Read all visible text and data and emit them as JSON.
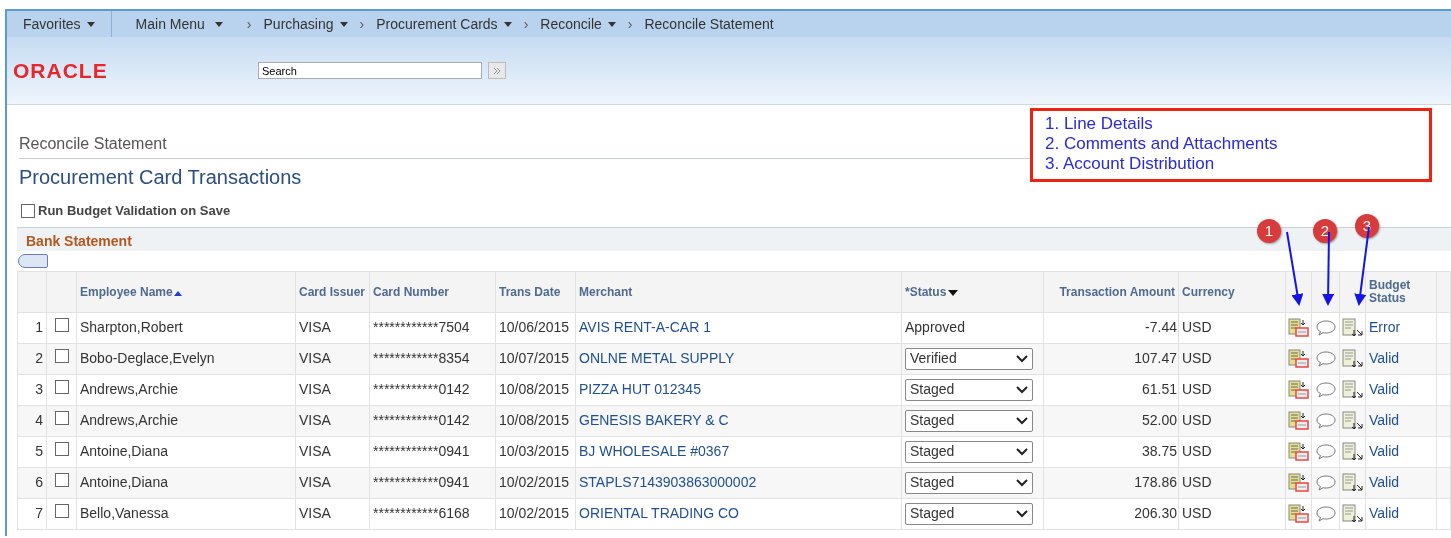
{
  "nav": {
    "favorites": "Favorites",
    "main_menu": "Main Menu",
    "separators": [
      "›",
      "›",
      "›",
      "›"
    ],
    "crumbs": [
      {
        "label": "Purchasing",
        "dropdown": true
      },
      {
        "label": "Procurement Cards",
        "dropdown": true
      },
      {
        "label": "Reconcile",
        "dropdown": true
      },
      {
        "label": "Reconcile Statement",
        "dropdown": false
      }
    ]
  },
  "banner": {
    "logo": "ORACLE",
    "search": {
      "value": "Search"
    }
  },
  "page": {
    "subtitle": "Reconcile Statement",
    "title": "Procurement Card Transactions",
    "budget_validation": {
      "label": "Run Budget Validation on Save",
      "checked": false
    }
  },
  "legend": {
    "items": [
      "1. Line Details",
      "2. Comments and Attachments",
      "3. Account Distribution"
    ]
  },
  "callouts": [
    {
      "number": "1"
    },
    {
      "number": "2"
    },
    {
      "number": "3"
    }
  ],
  "grid": {
    "title": "Bank Statement",
    "columns": [
      {
        "label": "Employee Name",
        "sorted": true,
        "ascending": true
      },
      {
        "label": "Card Issuer",
        "sorted": false
      },
      {
        "label": "Card Number",
        "sorted": false
      },
      {
        "label": "Trans Date",
        "sorted": false
      },
      {
        "label": "Merchant",
        "sorted": false
      },
      {
        "label": "*Status",
        "sorted": true,
        "ascending": false
      },
      {
        "label": "Transaction Amount",
        "sorted": false
      },
      {
        "label": "Currency",
        "sorted": false
      },
      {
        "label": "Budget Status",
        "sorted": false
      }
    ],
    "rows": [
      {
        "num": "1",
        "checked": false,
        "employee": "Sharpton,Robert",
        "issuer": "VISA",
        "card": "************7504",
        "date": "10/06/2015",
        "merchant": "AVIS RENT-A-CAR 1",
        "status": "Approved",
        "kind": "text",
        "amount": "-7.44",
        "currency": "USD",
        "budget_status": "Error"
      },
      {
        "num": "2",
        "checked": false,
        "employee": "Bobo-Deglace,Evelyn",
        "issuer": "VISA",
        "card": "************8354",
        "date": "10/07/2015",
        "merchant": "ONLNE METAL SUPPLY",
        "status": "Verified",
        "kind": "select",
        "amount": "107.47",
        "currency": "USD",
        "budget_status": "Valid"
      },
      {
        "num": "3",
        "checked": false,
        "employee": "Andrews,Archie",
        "issuer": "VISA",
        "card": "************0142",
        "date": "10/08/2015",
        "merchant": "PIZZA HUT 012345",
        "status": "Staged",
        "kind": "select",
        "amount": "61.51",
        "currency": "USD",
        "budget_status": "Valid"
      },
      {
        "num": "4",
        "checked": false,
        "employee": "Andrews,Archie",
        "issuer": "VISA",
        "card": "************0142",
        "date": "10/08/2015",
        "merchant": "GENESIS BAKERY & C",
        "status": "Staged",
        "kind": "select",
        "amount": "52.00",
        "currency": "USD",
        "budget_status": "Valid"
      },
      {
        "num": "5",
        "checked": false,
        "employee": "Antoine,Diana",
        "issuer": "VISA",
        "card": "************0941",
        "date": "10/03/2015",
        "merchant": "BJ WHOLESALE #0367",
        "status": "Staged",
        "kind": "select",
        "amount": "38.75",
        "currency": "USD",
        "budget_status": "Valid"
      },
      {
        "num": "6",
        "checked": false,
        "employee": "Antoine,Diana",
        "issuer": "VISA",
        "card": "************0941",
        "date": "10/02/2015",
        "merchant": "STAPLS7143903863000002",
        "status": "Staged",
        "kind": "select",
        "amount": "178.86",
        "currency": "USD",
        "budget_status": "Valid"
      },
      {
        "num": "7",
        "checked": false,
        "employee": "Bello,Vanessa",
        "issuer": "VISA",
        "card": "************6168",
        "date": "10/02/2015",
        "merchant": "ORIENTAL TRADING CO",
        "status": "Staged",
        "kind": "select",
        "amount": "206.30",
        "currency": "USD",
        "budget_status": "Valid"
      }
    ]
  }
}
